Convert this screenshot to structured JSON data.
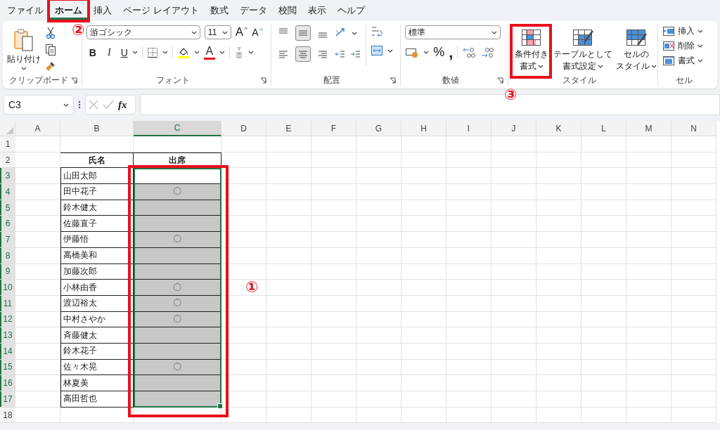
{
  "menu_tabs": [
    {
      "label": "ファイル",
      "selected": false
    },
    {
      "label": "ホーム",
      "selected": true
    },
    {
      "label": "挿入",
      "selected": false
    },
    {
      "label": "ページ レイアウト",
      "selected": false
    },
    {
      "label": "数式",
      "selected": false
    },
    {
      "label": "データ",
      "selected": false
    },
    {
      "label": "校閲",
      "selected": false
    },
    {
      "label": "表示",
      "selected": false
    },
    {
      "label": "ヘルプ",
      "selected": false
    }
  ],
  "ribbon": {
    "clipboard": {
      "paste": "貼り付け",
      "group": "クリップボード"
    },
    "font": {
      "name": "游ゴシック",
      "size": "11",
      "grow": "A",
      "shrink": "A",
      "bold": "B",
      "italic": "I",
      "underline": "U",
      "font_color": "A",
      "group": "フォント"
    },
    "alignment": {
      "vertical": [
        {
          "kind": "top",
          "selected": false
        },
        {
          "kind": "middle",
          "selected": true
        },
        {
          "kind": "bottom",
          "selected": false
        }
      ],
      "horizontal": [
        {
          "kind": "left",
          "selected": false
        },
        {
          "kind": "center",
          "selected": true
        },
        {
          "kind": "right",
          "selected": false
        }
      ],
      "group": "配置"
    },
    "number": {
      "format": "標準",
      "percent": "%",
      "comma": ",",
      "group": "数値"
    },
    "styles": {
      "buttons": [
        {
          "kind": "conditional",
          "line1": "条件付き",
          "line2": "書式"
        },
        {
          "kind": "table",
          "line1": "テーブルとして",
          "line2": "書式設定"
        },
        {
          "kind": "cell",
          "line1": "セルの",
          "line2": "スタイル"
        }
      ],
      "group": "スタイル"
    },
    "cells": {
      "buttons": [
        {
          "kind": "insert",
          "label": "挿入"
        },
        {
          "kind": "delete",
          "label": "削除"
        },
        {
          "kind": "format",
          "label": "書式"
        }
      ],
      "group": "セル"
    }
  },
  "formula_bar": {
    "name_box": "C3",
    "function_label": "fx"
  },
  "sheet": {
    "columns": [
      {
        "label": "A",
        "selected": false
      },
      {
        "label": "B",
        "selected": false
      },
      {
        "label": "C",
        "selected": true
      },
      {
        "label": "D",
        "selected": false
      },
      {
        "label": "E",
        "selected": false
      },
      {
        "label": "F",
        "selected": false
      },
      {
        "label": "G",
        "selected": false
      },
      {
        "label": "H",
        "selected": false
      },
      {
        "label": "I",
        "selected": false
      },
      {
        "label": "J",
        "selected": false
      },
      {
        "label": "K",
        "selected": false
      },
      {
        "label": "L",
        "selected": false
      },
      {
        "label": "M",
        "selected": false
      },
      {
        "label": "N",
        "selected": false
      }
    ],
    "rows": [
      {
        "number": "1",
        "selected": false,
        "kind": "blank"
      },
      {
        "number": "2",
        "selected": false,
        "kind": "header",
        "name": "氏名",
        "attendance": "出席"
      },
      {
        "number": "3",
        "selected": true,
        "kind": "entry",
        "name": "山田太郎",
        "highlighted": false
      },
      {
        "number": "4",
        "selected": true,
        "kind": "entry",
        "name": "田中花子",
        "attendance": "〇",
        "highlighted": true
      },
      {
        "number": "5",
        "selected": true,
        "kind": "entry",
        "name": "鈴木健太",
        "highlighted": true
      },
      {
        "number": "6",
        "selected": true,
        "kind": "entry",
        "name": "佐藤直子",
        "highlighted": true
      },
      {
        "number": "7",
        "selected": true,
        "kind": "entry",
        "name": "伊藤悟",
        "attendance": "〇",
        "highlighted": true
      },
      {
        "number": "8",
        "selected": true,
        "kind": "entry",
        "name": "高橋美和",
        "highlighted": true
      },
      {
        "number": "9",
        "selected": true,
        "kind": "entry",
        "name": "加藤次郎",
        "highlighted": true
      },
      {
        "number": "10",
        "selected": true,
        "kind": "entry",
        "name": "小林由香",
        "attendance": "〇",
        "highlighted": true
      },
      {
        "number": "11",
        "selected": true,
        "kind": "entry",
        "name": "渡辺裕太",
        "attendance": "〇",
        "highlighted": true
      },
      {
        "number": "12",
        "selected": true,
        "kind": "entry",
        "name": "中村さやか",
        "attendance": "〇",
        "highlighted": true
      },
      {
        "number": "13",
        "selected": true,
        "kind": "entry",
        "name": "斉藤健太",
        "highlighted": true
      },
      {
        "number": "14",
        "selected": true,
        "kind": "entry",
        "name": "鈴木花子",
        "highlighted": true
      },
      {
        "number": "15",
        "selected": true,
        "kind": "entry",
        "name": "佐々木晃",
        "attendance": "〇",
        "highlighted": true
      },
      {
        "number": "16",
        "selected": true,
        "kind": "entry",
        "name": "林夏美",
        "highlighted": true
      },
      {
        "number": "17",
        "selected": true,
        "kind": "entry",
        "name": "高田哲也",
        "highlighted": true
      },
      {
        "number": "18",
        "selected": false,
        "kind": "blank"
      }
    ]
  },
  "annotations": [
    {
      "label": "②",
      "kind": "tab"
    },
    {
      "label": "③",
      "kind": "button"
    },
    {
      "label": "①",
      "kind": "range"
    }
  ]
}
